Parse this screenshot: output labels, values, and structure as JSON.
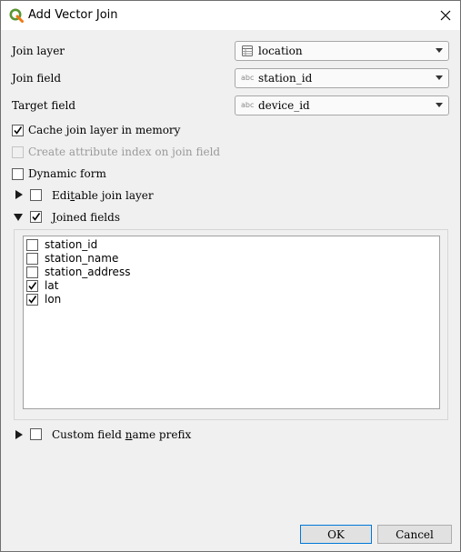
{
  "dialog": {
    "title": "Add Vector Join"
  },
  "join_layer": {
    "label": "Join layer",
    "value": "location",
    "icon": "vector-layer-table-icon"
  },
  "join_field": {
    "label": "Join field",
    "value": "station_id",
    "type_badge": "abc"
  },
  "target_field": {
    "label": "Target field",
    "value": "device_id",
    "type_badge": "abc"
  },
  "options": {
    "cache": {
      "label": "Cache join layer in memory",
      "checked": true
    },
    "attr_index": {
      "label": "Create attribute index on join field",
      "checked": false,
      "enabled": false
    },
    "dynamic_form": {
      "label": "Dynamic form",
      "checked": false
    }
  },
  "editable": {
    "label_pre": "Edi",
    "label_u": "t",
    "label_post": "able join layer",
    "checked": false,
    "expanded": false
  },
  "joined": {
    "label_u": "J",
    "label_post": "oined fields",
    "checked": true,
    "expanded": true
  },
  "fields": [
    {
      "name": "station_id",
      "checked": false
    },
    {
      "name": "station_name",
      "checked": false
    },
    {
      "name": "station_address",
      "checked": false
    },
    {
      "name": "lat",
      "checked": true
    },
    {
      "name": "lon",
      "checked": true
    }
  ],
  "prefix": {
    "label_pre": "Custom field ",
    "label_u": "n",
    "label_post": "ame prefix",
    "checked": false,
    "expanded": false
  },
  "buttons": {
    "ok": "OK",
    "cancel": "Cancel"
  },
  "colors": {
    "qgis_green": "#589632",
    "qgis_yellow": "#ee7913",
    "focus_blue": "#0078d7"
  }
}
